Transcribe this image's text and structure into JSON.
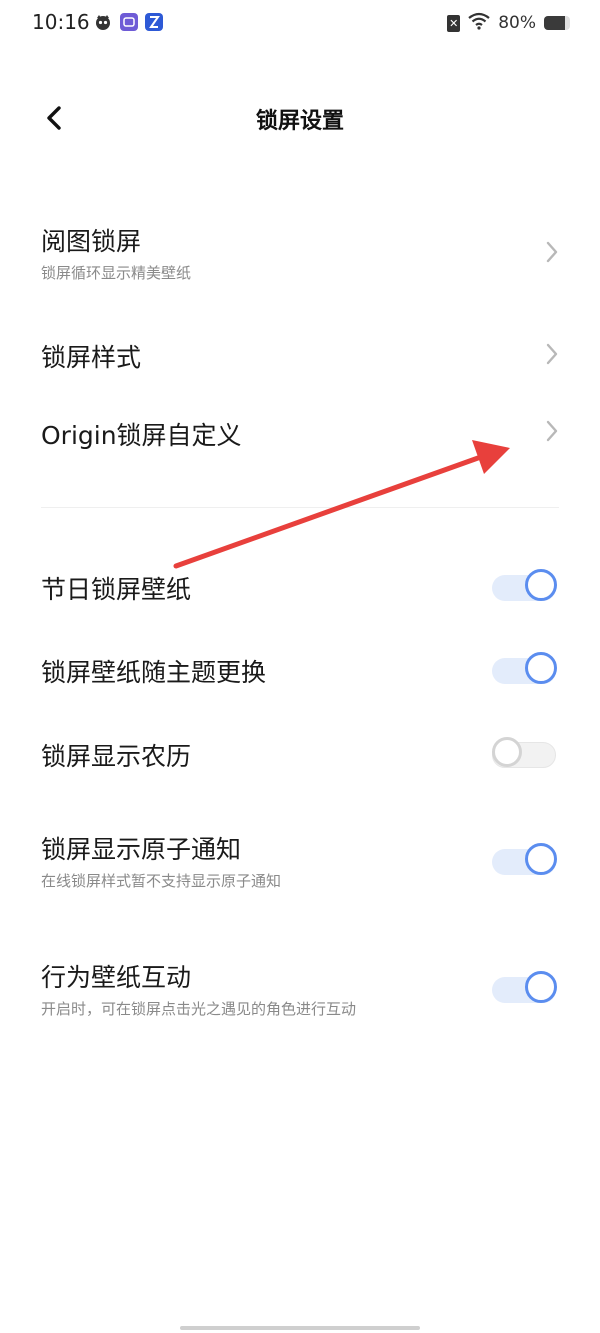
{
  "status_bar": {
    "time": "10:16",
    "battery_text": "80%",
    "battery_level": 0.8,
    "icons": [
      "cat-app-icon",
      "purple-app-icon",
      "blue-app-icon",
      "sim-x-icon",
      "wifi-icon",
      "battery-icon"
    ]
  },
  "header": {
    "title": "锁屏设置",
    "back_icon": "chevron-left-icon"
  },
  "nav_items": [
    {
      "title": "阅图锁屏",
      "subtitle": "锁屏循环显示精美壁纸"
    },
    {
      "title": "锁屏样式"
    },
    {
      "title": "Origin锁屏自定义"
    }
  ],
  "toggle_items": [
    {
      "title": "节日锁屏壁纸",
      "on": true
    },
    {
      "title": "锁屏壁纸随主题更换",
      "on": true
    },
    {
      "title": "锁屏显示农历",
      "on": false
    },
    {
      "title": "锁屏显示原子通知",
      "subtitle": "在线锁屏样式暂不支持显示原子通知",
      "on": true
    },
    {
      "title": "行为壁纸互动",
      "subtitle": "开启时，可在锁屏点击光之遇见的角色进行互动",
      "on": true
    }
  ],
  "colors": {
    "accent": "#5b8def",
    "toggle_track_on": "#e3ecfb",
    "annotation_arrow": "#e8403c"
  }
}
